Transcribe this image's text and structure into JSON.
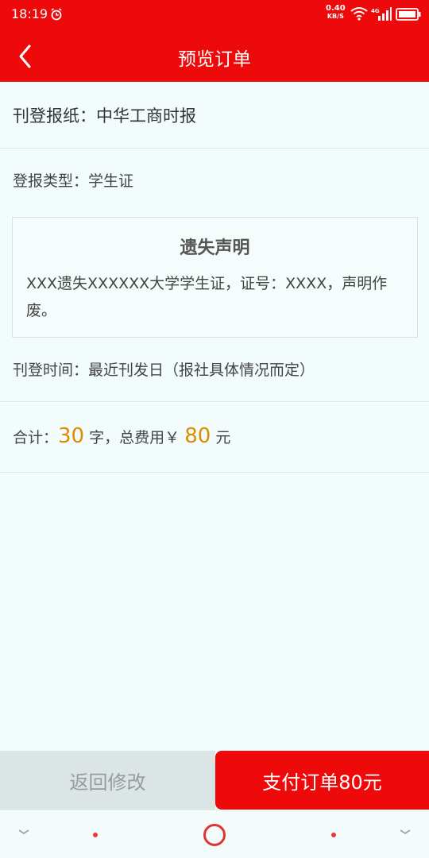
{
  "status_bar": {
    "time": "18:19",
    "net_speed_value": "0.40",
    "net_speed_unit": "KB/S",
    "network_type": "4G",
    "icons": [
      "alarm-icon",
      "wifi-icon",
      "signal-icon",
      "battery-icon"
    ]
  },
  "header": {
    "title": "预览订单",
    "back_icon": "chevron-left-icon"
  },
  "order": {
    "newspaper": "刊登报纸：中华工商时报",
    "type": "登报类型：学生证",
    "notice": {
      "title": "遗失声明",
      "body": "XXX遗失XXXXXX大学学生证，证号：XXXX，声明作废。"
    },
    "publish_time": "刊登时间：最近刊发日（报社具体情况而定）",
    "total": {
      "prefix": "合计：",
      "char_count": "30",
      "char_unit": " 字，总费用￥ ",
      "fee": "80",
      "fee_unit": " 元"
    }
  },
  "actions": {
    "modify_label": "返回修改",
    "pay_label": "支付订单80元"
  },
  "colors": {
    "brand_red": "#ee0a0a",
    "highlight_orange": "#e08a00",
    "background": "#f2fcfc"
  }
}
